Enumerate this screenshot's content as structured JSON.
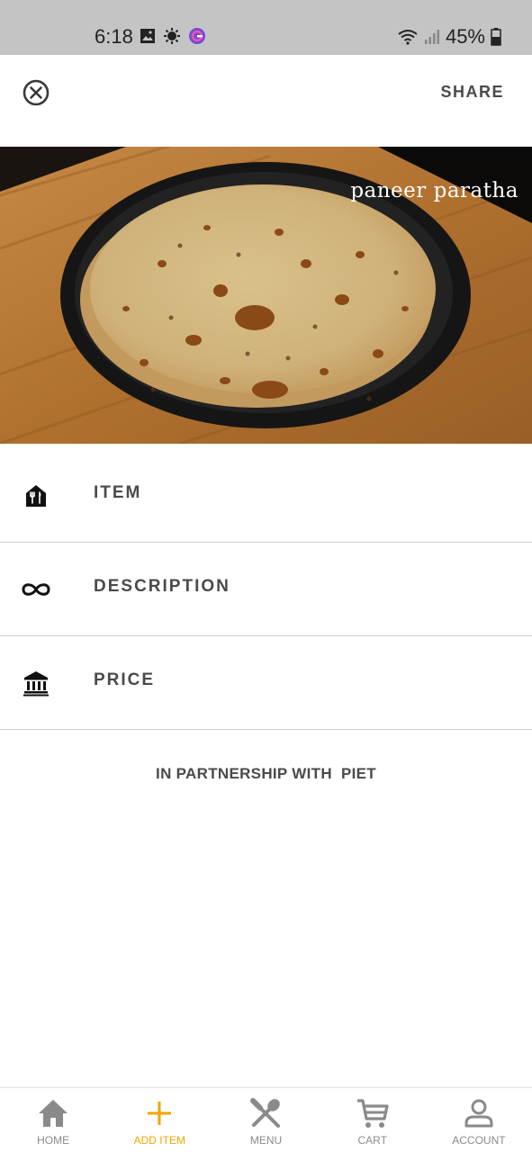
{
  "status_bar": {
    "time": "6:18",
    "battery": "45%",
    "left_icons": [
      "image-icon",
      "gear-notification-icon",
      "app-notification-icon"
    ],
    "right_icons": [
      "wifi-icon",
      "signal-icon",
      "battery-icon"
    ]
  },
  "header": {
    "close_icon": "close-circle-icon",
    "share_label": "SHARE"
  },
  "hero": {
    "caption": "paneer paratha"
  },
  "rows": [
    {
      "label": "ITEM",
      "icon": "restaurant-icon"
    },
    {
      "label": "DESCRIPTION",
      "icon": "infinity-icon"
    },
    {
      "label": "PRICE",
      "icon": "bank-icon"
    }
  ],
  "partner_text": "IN PARTNERSHIP WITH  PIET",
  "bottom_nav": {
    "items": [
      {
        "label": "HOME",
        "icon": "home-icon",
        "active": false
      },
      {
        "label": "ADD ITEM",
        "icon": "plus-icon",
        "active": true
      },
      {
        "label": "MENU",
        "icon": "utensils-icon",
        "active": false
      },
      {
        "label": "CART",
        "icon": "cart-icon",
        "active": false
      },
      {
        "label": "ACCOUNT",
        "icon": "user-icon",
        "active": false
      }
    ],
    "active_color": "#f0a500",
    "inactive_color": "#8a8a8a"
  }
}
